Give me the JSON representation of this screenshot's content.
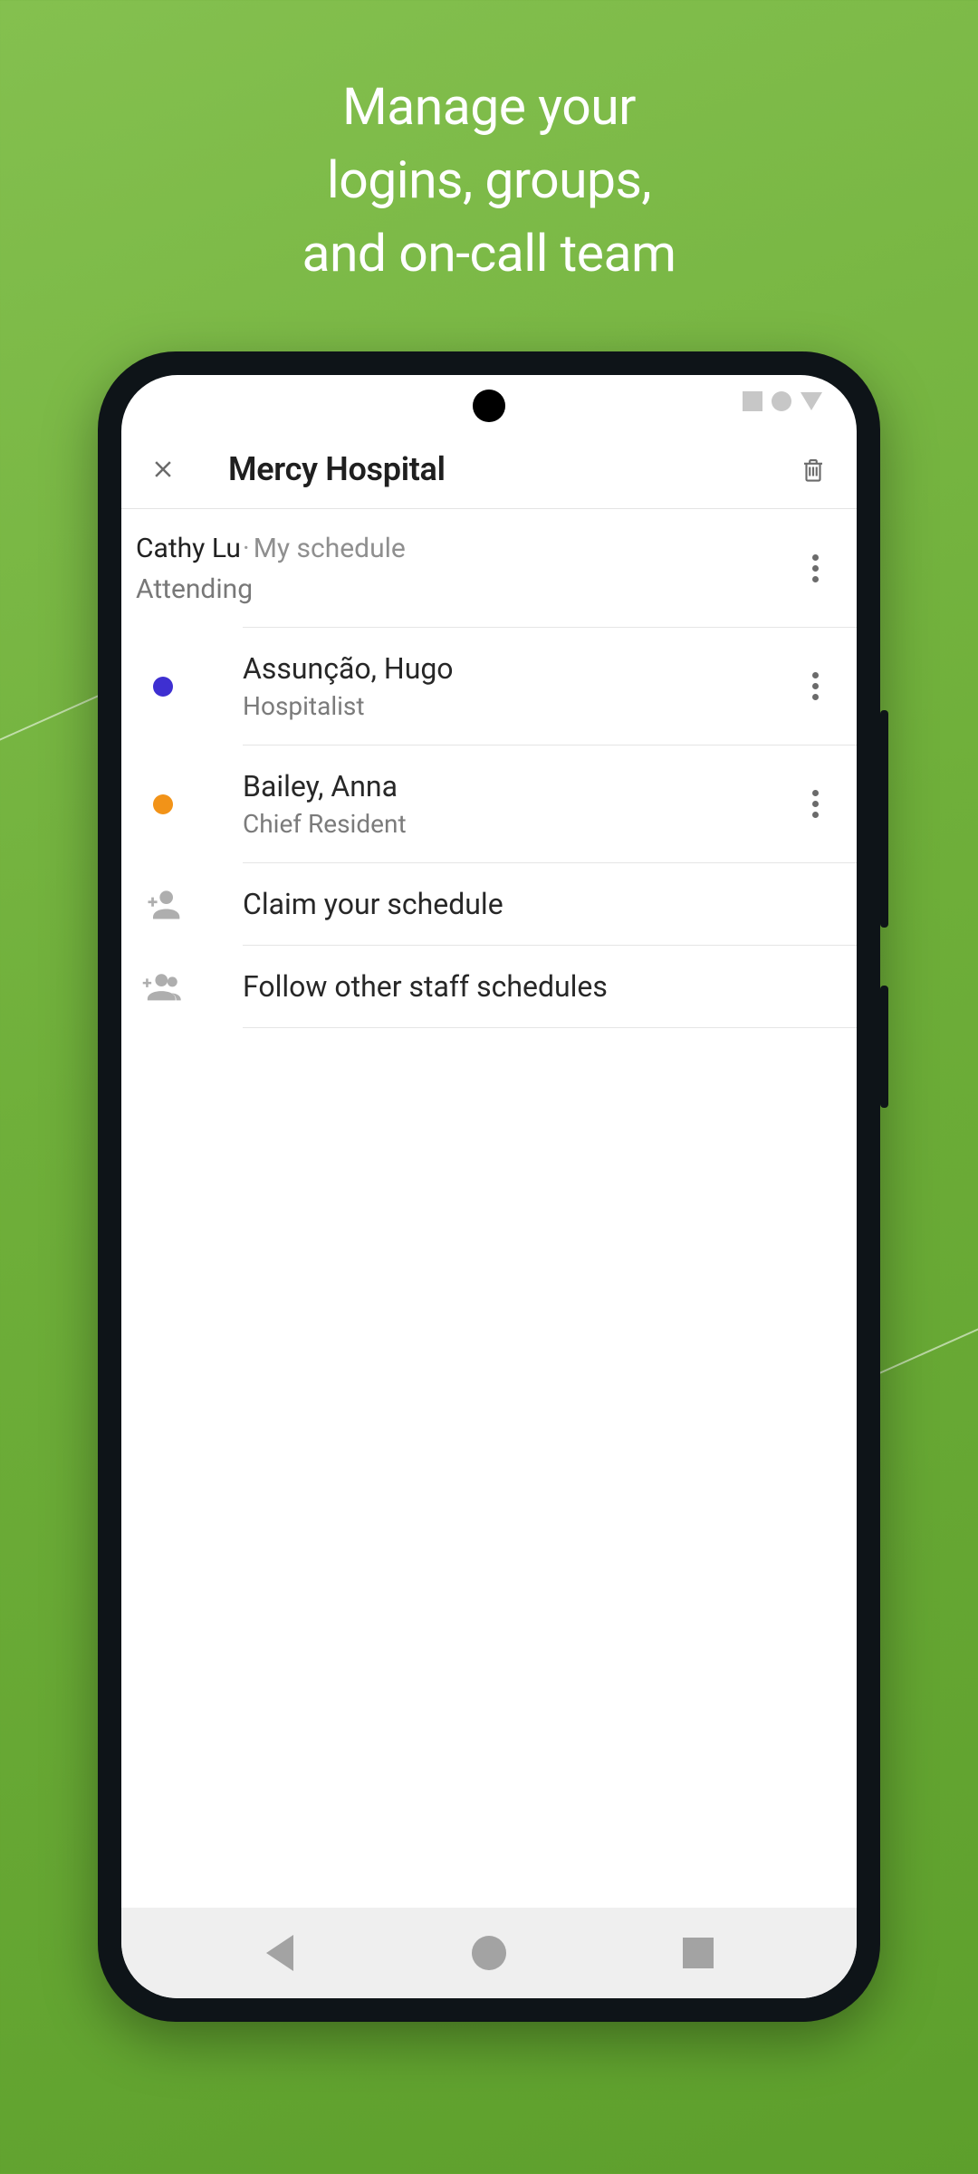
{
  "hero": {
    "line1": "Manage your",
    "line2": "logins, groups,",
    "line3": "and on-call team"
  },
  "appbar": {
    "title": "Mercy Hospital"
  },
  "self": {
    "name": "Cathy Lu",
    "badge": "My schedule",
    "role": "Attending"
  },
  "people": [
    {
      "name": "Assunção, Hugo",
      "role": "Hospitalist",
      "dot_color": "#3e2fd1"
    },
    {
      "name": "Bailey, Anna",
      "role": "Chief Resident",
      "dot_color": "#f29318"
    }
  ],
  "actions": {
    "claim": "Claim your schedule",
    "follow": "Follow other staff schedules"
  },
  "icons": {
    "close": "close-icon",
    "trash": "trash-icon",
    "overflow": "more-vert-icon",
    "claim": "person-add-icon",
    "follow": "group-add-icon",
    "nav_back": "nav-back-icon",
    "nav_home": "nav-home-icon",
    "nav_recent": "nav-recent-icon"
  }
}
